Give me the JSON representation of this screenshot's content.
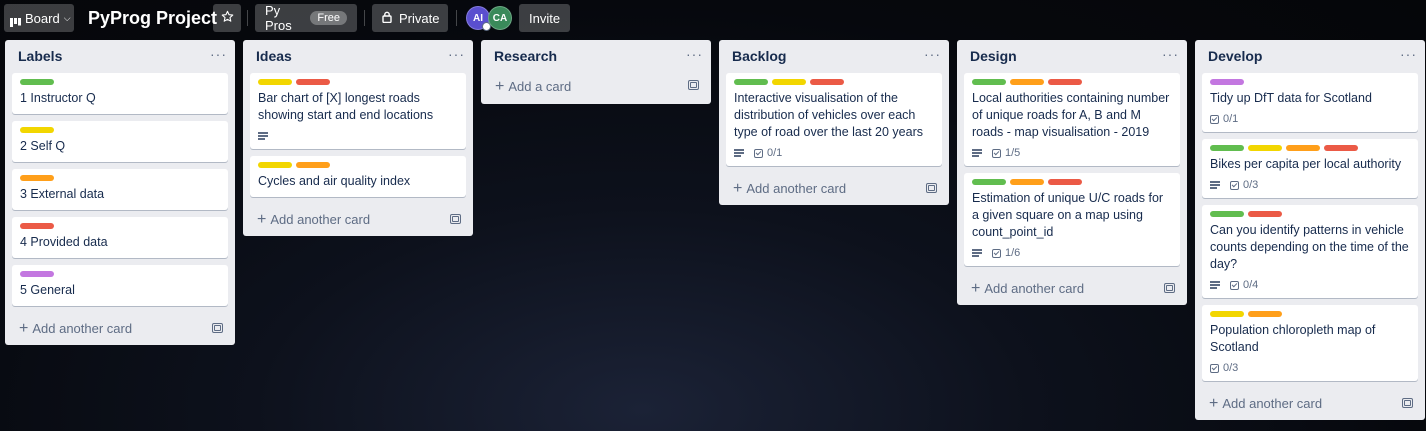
{
  "header": {
    "view_label": "Board",
    "board_title": "PyProg Project",
    "workspace_label": "Py Pros",
    "workspace_badge": "Free",
    "visibility_label": "Private",
    "invite_label": "Invite",
    "members": [
      {
        "initials": "AI",
        "color": "#5a4fcf"
      },
      {
        "initials": "CA",
        "color": "#3a8a5a"
      }
    ]
  },
  "colors": {
    "green": "#61bd4f",
    "yellow": "#f2d600",
    "orange": "#ff9f1a",
    "red": "#eb5a46",
    "purple": "#c377e0"
  },
  "footer": {
    "add_another_card": "Add another card",
    "add_a_card": "Add a card"
  },
  "lists": [
    {
      "title": "Labels",
      "cards": [
        {
          "labels": [
            "green"
          ],
          "title": "1 Instructor Q"
        },
        {
          "labels": [
            "yellow"
          ],
          "title": "2 Self Q"
        },
        {
          "labels": [
            "orange"
          ],
          "title": "3 External data"
        },
        {
          "labels": [
            "red"
          ],
          "title": "4 Provided data"
        },
        {
          "labels": [
            "purple"
          ],
          "title": "5 General"
        }
      ]
    },
    {
      "title": "Ideas",
      "cards": [
        {
          "labels": [
            "yellow",
            "red"
          ],
          "title": "Bar chart of [X] longest roads showing start and end locations",
          "description": true
        },
        {
          "labels": [
            "yellow",
            "orange"
          ],
          "title": "Cycles and air quality index"
        }
      ]
    },
    {
      "title": "Research",
      "cards": []
    },
    {
      "title": "Backlog",
      "cards": [
        {
          "labels": [
            "green",
            "yellow",
            "red"
          ],
          "title": "Interactive visualisation of the distribution of vehicles over each type of road over the last 20 years",
          "description": true,
          "checklist": "0/1"
        }
      ]
    },
    {
      "title": "Design",
      "cards": [
        {
          "labels": [
            "green",
            "orange",
            "red"
          ],
          "title": "Local authorities containing number of unique roads for A, B and M roads - map visualisation - 2019",
          "description": true,
          "checklist": "1/5"
        },
        {
          "labels": [
            "green",
            "orange",
            "red"
          ],
          "title": "Estimation of unique U/C roads for a given square on a map using count_point_id",
          "description": true,
          "checklist": "1/6"
        }
      ]
    },
    {
      "title": "Develop",
      "cards": [
        {
          "labels": [
            "purple"
          ],
          "title": "Tidy up DfT data for Scotland",
          "checklist": "0/1"
        },
        {
          "labels": [
            "green",
            "yellow",
            "orange",
            "red"
          ],
          "title": "Bikes per capita per local authority",
          "description": true,
          "checklist": "0/3"
        },
        {
          "labels": [
            "green",
            "red"
          ],
          "title": "Can you identify patterns in vehicle counts depending on the time of the day?",
          "description": true,
          "checklist": "0/4"
        },
        {
          "labels": [
            "yellow",
            "orange"
          ],
          "title": "Population chloropleth map of Scotland",
          "checklist": "0/3"
        }
      ]
    }
  ]
}
